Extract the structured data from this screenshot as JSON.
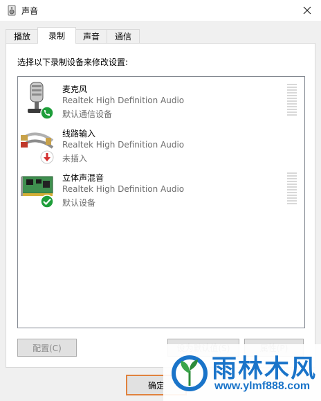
{
  "window": {
    "title": "声音",
    "title_icon": "speaker-icon",
    "close_icon": "close-icon"
  },
  "tabs": [
    {
      "label": "播放"
    },
    {
      "label": "录制",
      "active": true
    },
    {
      "label": "声音"
    },
    {
      "label": "通信"
    }
  ],
  "panel": {
    "instruction": "选择以下录制设备来修改设置:",
    "devices": [
      {
        "name": "麦克风",
        "description": "Realtek High Definition Audio",
        "status": "默认通信设备",
        "icon": "microphone-icon",
        "badge": "phone-badge-icon",
        "badge_color": "#1e9e3a",
        "level": 0
      },
      {
        "name": "线路输入",
        "description": "Realtek High Definition Audio",
        "status": "未插入",
        "icon": "line-in-cable-icon",
        "badge": "unplugged-badge-icon",
        "badge_color": "#d32f2f"
      },
      {
        "name": "立体声混音",
        "description": "Realtek High Definition Audio",
        "status": "默认设备",
        "icon": "sound-card-icon",
        "badge": "default-check-badge-icon",
        "badge_color": "#1e9e3a",
        "level": 0
      }
    ]
  },
  "buttons": {
    "configure": "配置(C)",
    "set_default": "设为默认值(S)",
    "properties": "属性(P)",
    "ok": "确定"
  },
  "watermark": {
    "title": "雨林木风",
    "url": "www.ylmf888.com",
    "logo": "ylmf-logo",
    "color": "#1a74c9"
  }
}
